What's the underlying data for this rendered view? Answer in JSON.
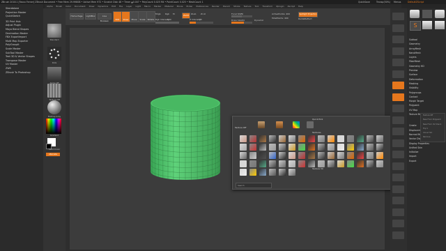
{
  "title_bar": {
    "text": "ZBrush 2018.1 [Faxxx Ferner]   ZBrush Document   • Free Mem 29.998GB • Active Mem 972 • Scratch Disk 48 • Timer ▲0.007 • PolyCount 0.025 Mil • PointCount 0.025 • MeshCount 1",
    "right_items": [
      "QuickSave",
      "Transp(50%)",
      "Menus",
      "DefaultZScript"
    ]
  },
  "menu_bar": {
    "items": [
      "Alpha",
      "Brush",
      "Color",
      "Document",
      "Draw",
      "Dynamics",
      "Edit",
      "File",
      "Layer",
      "Light",
      "Macro",
      "Marker",
      "Material",
      "Movie",
      "Picker",
      "Preferences",
      "Render",
      "Stencil",
      "Stroke",
      "Texture",
      "Tool",
      "Transform",
      "Zplugin",
      "Zscript",
      "Help"
    ]
  },
  "left_nav": {
    "items": [
      "Standalone",
      "Projection Master",
      "QuickSketch",
      "3D Print Hub",
      "Adjust Plugin",
      "Maya Blend Shapes",
      "Decimation Master",
      "FBX ExportImport",
      "Multi Map Exporter",
      "PolyGroupIt",
      "Scale Master",
      "SubTool Master",
      "Text 3D & Vector Shapes",
      "Transpose Master",
      "UV Master",
      "ZWS",
      "ZBrush To Photoshop"
    ]
  },
  "left_tools": {
    "captions": [
      "Standard",
      "DragRect",
      "Dots",
      "Alpha Off",
      "Texture Off",
      "MatCap Gray",
      "Gradient",
      "SwitchColor",
      "Alternate"
    ]
  },
  "top_shelf": {
    "home_page": "Home Page",
    "lightbox": "LightBox",
    "live_boolean": "Live Boolean",
    "edit": "Edit",
    "draw": "Draw",
    "move": "Move",
    "scale": "Scale",
    "rotate": "Rotate",
    "mrgb": "Mrgb",
    "rgb": "Rgb",
    "m": "M",
    "zadd": "Zadd",
    "zsub": "Zsub",
    "zcut": "Zcut",
    "rgb_intensity_label": "Rgb Intensity",
    "rgb_intensity_value": "100",
    "z_intensity_label": "Z Intensity",
    "z_intensity_value": "25",
    "focal_shift_label": "Focal Shift",
    "focal_shift_value": "0",
    "draw_size_label": "Draw Size",
    "draw_size_value": "64",
    "dynamic": "Dynamic",
    "active_points": "ActivePoints: 400",
    "total_points": "TotalPoints: 400",
    "spotlight": "Spotlight Projection",
    "radial": "RadialReflect"
  },
  "right_bar": {
    "labels": [
      "BPR",
      "SPix 3",
      "Scroll",
      "Zoom",
      "Actual",
      "AAHalf",
      "Persp",
      "Floor",
      "Local",
      "L.Sym",
      "Frame",
      "Move",
      "Scale",
      "Rotate",
      "Line Fill",
      "PolyF",
      "Transp",
      "Ghost",
      "Solo",
      "Xpose"
    ]
  },
  "right_panel": {
    "items": [
      "Subtool",
      "Geometry",
      "ArrayMesh",
      "NanoMesh",
      "Layers",
      "FiberMesh",
      "Geometry HD",
      "Preview",
      "Surface",
      "Deformation",
      "Masking",
      "Visibility",
      "Polygroups",
      "Contact",
      "Morph Target",
      "Polypaint",
      "UV Map",
      "Texture Map",
      "Create",
      "Displacement Map",
      "Normal Map",
      "Vector Displacement Map",
      "Display Properties",
      "Unified Skin",
      "Initialize",
      "Import",
      "Export"
    ]
  },
  "texture_submenu": {
    "items": [
      "Texture Off",
      "New From Polypaint",
      "New From UV Check",
      "Flip V",
      "Clone Txtr",
      "Remove"
    ]
  },
  "quick_pick": {
    "title": "Quick Pick",
    "texture_off": "Texture Off",
    "textures_header": "Textures",
    "search_label": "Search",
    "labels": [
      "Texture 01",
      "Texture 02",
      "Texture 03",
      "Texture 04",
      "Texture 05",
      "Texture 06",
      "Texture 07",
      "Texture 08",
      "Texture 09"
    ],
    "footer_label": "Texture 30"
  },
  "colors": {
    "accent": "#e6771d",
    "mesh_green": "#4fc46a",
    "background": "#262626"
  }
}
